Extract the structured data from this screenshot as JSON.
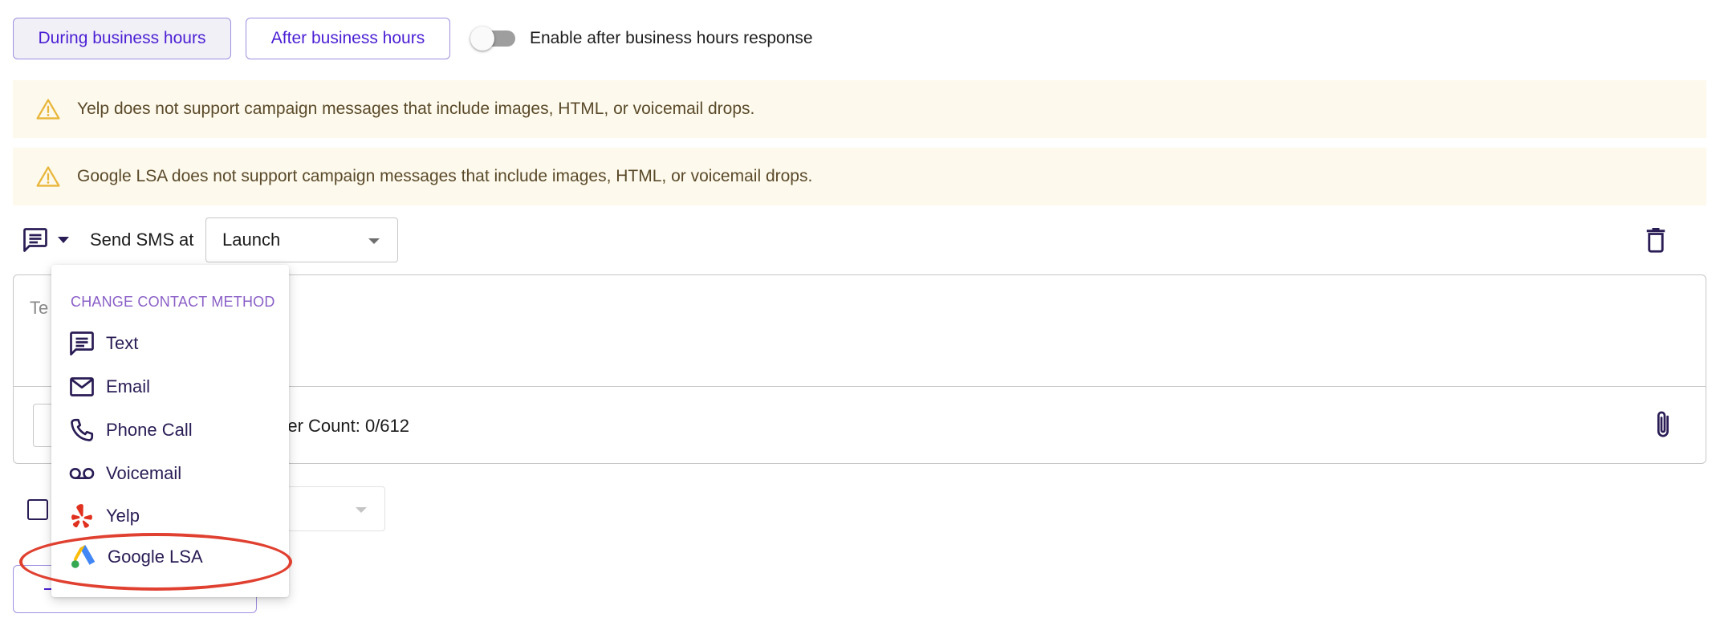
{
  "tabs": {
    "during_label": "During business hours",
    "after_label": "After business hours"
  },
  "toggle": {
    "label": "Enable after business hours response",
    "enabled": false
  },
  "banners": [
    {
      "text": "Yelp does not support campaign messages that include images, HTML, or voicemail drops."
    },
    {
      "text": "Google LSA does not support campaign messages that include images, HTML, or voicemail drops."
    }
  ],
  "send_row": {
    "action_label": "Send SMS",
    "at_label": "at",
    "timing_value": "Launch"
  },
  "message": {
    "placeholder_fragment": "Te",
    "char_count_fragment": "acter Count: 0/612"
  },
  "menu": {
    "header": "CHANGE CONTACT METHOD",
    "items": [
      {
        "label": "Text",
        "icon": "message-icon"
      },
      {
        "label": "Email",
        "icon": "email-icon"
      },
      {
        "label": "Phone Call",
        "icon": "phone-icon"
      },
      {
        "label": "Voicemail",
        "icon": "voicemail-icon"
      },
      {
        "label": "Yelp",
        "icon": "yelp-icon"
      },
      {
        "label": "Google LSA",
        "icon": "google-ads-icon"
      }
    ]
  },
  "colors": {
    "accent": "#4b1fd4",
    "icon_dark": "#2a1c55",
    "banner_bg": "#fdf9ec",
    "warning_icon": "#e8b63a",
    "highlight": "#e04030"
  }
}
